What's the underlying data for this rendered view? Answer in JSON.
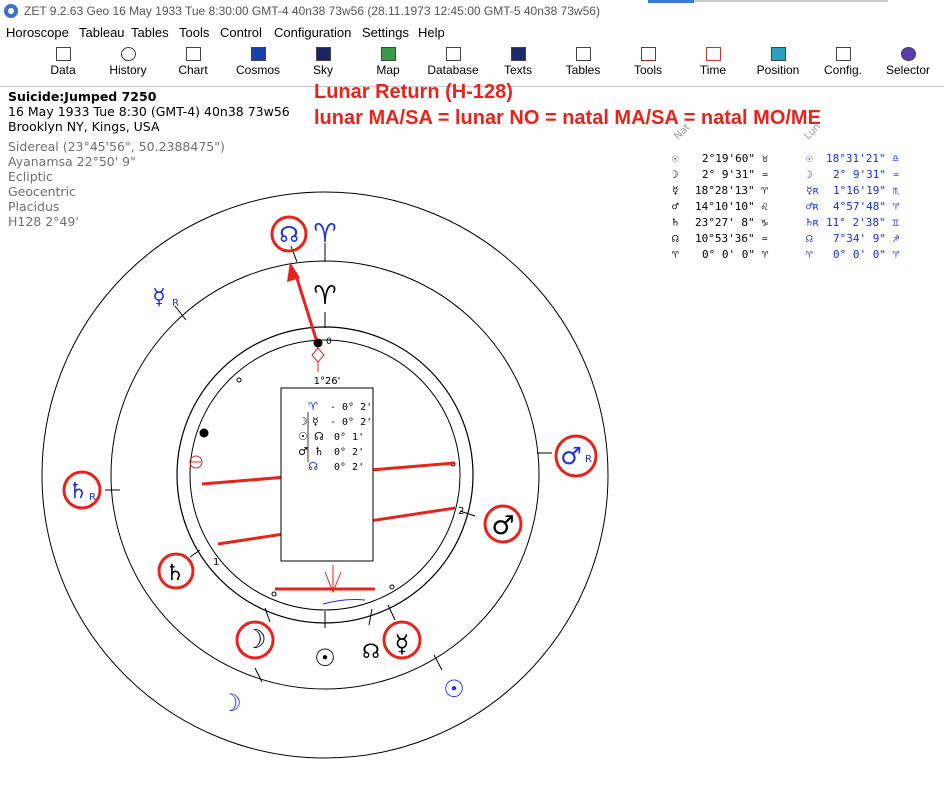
{
  "window": {
    "title": "ZET 9.2.63 Geo   16 May 1933  Tue   8:30:00 GMT-4 40n38  73w56  (28.11.1973  12:45:00 GMT-5 40n38 73w56)"
  },
  "menu": [
    "Horoscope",
    "Tableau",
    "Tables",
    "Tools",
    "Control",
    "Configuration",
    "Settings",
    "Help"
  ],
  "toolbar": [
    "Data",
    "History",
    "Chart",
    "Cosmos",
    "Sky",
    "Map",
    "Database",
    "Texts",
    "Tables",
    "Tools",
    "Time",
    "Position",
    "Config.",
    "Selector"
  ],
  "toolbar_icons": [
    "grid-icon",
    "history-icon",
    "chart-icon",
    "cosmos-icon",
    "sky-icon",
    "map-icon",
    "database-icon",
    "texts-icon",
    "tables-icon",
    "tools-icon",
    "time-icon",
    "position-icon",
    "config-icon",
    "selector-icon"
  ],
  "info": {
    "name": "Suicide:Jumped 7250",
    "date": "16 May 1933  Tue   8:30 (GMT-4) 40n38  73w56",
    "place": "Brooklyn NY, Kings, USA",
    "details": [
      "Sidereal (23°45'56\", 50.2388475\")",
      "Ayanamsa 22°50' 9\"",
      "Ecliptic",
      "Geocentric",
      "Placidus",
      "H128   2°49'"
    ]
  },
  "annotation": {
    "line1": "Lunar Return (H-128)",
    "line2": "lunar MA/SA = lunar NO = natal MA/SA = natal MO/ME"
  },
  "table": {
    "natal_header": "Nat",
    "lunar_header": "Lun",
    "rows": [
      {
        "g1": "☉",
        "v1": "2°19'60\" ♉",
        "g2": "☉",
        "v2": "18°31'21\" ♎"
      },
      {
        "g1": "☽",
        "v1": "2° 9'31\" ♒",
        "g2": "☽",
        "v2": "2° 9'31\" ♒"
      },
      {
        "g1": "☿",
        "v1": "18°28'13\" ♈",
        "g2": "☿ʀ",
        "v2": "1°16'19\" ♏"
      },
      {
        "g1": "♂",
        "v1": "14°10'10\" ♌",
        "g2": "♂ʀ",
        "v2": "4°57'48\" ♈"
      },
      {
        "g1": "♄",
        "v1": "23°27' 8\" ♑",
        "g2": "♄ʀ",
        "v2": "11° 2'38\" ♊"
      },
      {
        "g1": "☊",
        "v1": "10°53'36\" ♒",
        "g2": "☊",
        "v2": "7°34' 9\" ♐"
      },
      {
        "g1": "♈",
        "v1": "0° 0' 0\" ♈",
        "g2": "♈",
        "v2": "0° 0' 0\" ♈"
      }
    ]
  },
  "aspect_box": {
    "top_label": "1°26'",
    "rows": [
      {
        "a": "♈",
        "b": "",
        "val": "- 0° 2'"
      },
      {
        "a": "☽",
        "b": "☿",
        "val": "- 0° 2'"
      },
      {
        "a": "☉",
        "b": "☊",
        "val": "0° 1'"
      },
      {
        "a": "♂",
        "b": "♄",
        "val": "0° 2'"
      },
      {
        "a": "☊",
        "b": "",
        "val": "0° 2'"
      }
    ]
  },
  "chart_glyphs": {
    "outer_aries": "♈",
    "outer_node": "☊",
    "outer_mercury": "☿",
    "outer_saturn": "♄",
    "outer_mars": "♂",
    "outer_moon": "☽",
    "outer_sun": "☉",
    "retro": "R",
    "inner_aries": "♈",
    "inner_mars": "♂",
    "inner_saturn": "♄",
    "inner_moon": "☽",
    "inner_sun": "☉",
    "inner_node": "☊",
    "inner_mercury": "☿",
    "house_1": "1",
    "house_2": "2",
    "house_0": "0"
  },
  "colors": {
    "annotation_red": "#e8231c",
    "lunar_blue": "#1a2de0",
    "ring": "#000000"
  }
}
